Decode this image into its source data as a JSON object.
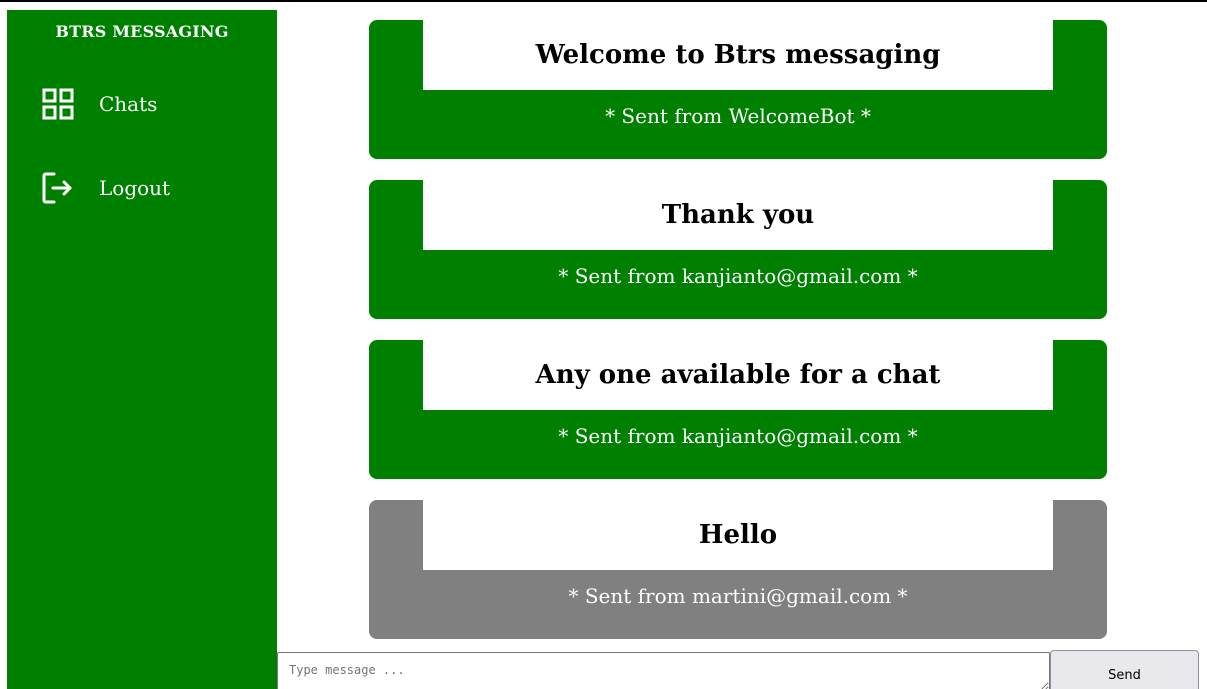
{
  "app": {
    "brand": "BTRS MESSAGING",
    "accent_color": "#008000",
    "other_sender_color": "#808080"
  },
  "sidebar": {
    "items": [
      {
        "label": "Chats",
        "icon": "grid-icon"
      },
      {
        "label": "Logout",
        "icon": "logout-icon"
      }
    ]
  },
  "messages": [
    {
      "text": "Welcome to Btrs messaging",
      "sender_line": "* Sent from WelcomeBot *",
      "own": true
    },
    {
      "text": "Thank you",
      "sender_line": "* Sent from kanjianto@gmail.com *",
      "own": true
    },
    {
      "text": "Any one available for a chat",
      "sender_line": "* Sent from kanjianto@gmail.com *",
      "own": true
    },
    {
      "text": "Hello",
      "sender_line": "* Sent from martini@gmail.com *",
      "own": false
    }
  ],
  "composer": {
    "placeholder": "Type message ...",
    "value": "",
    "send_label": "Send"
  }
}
